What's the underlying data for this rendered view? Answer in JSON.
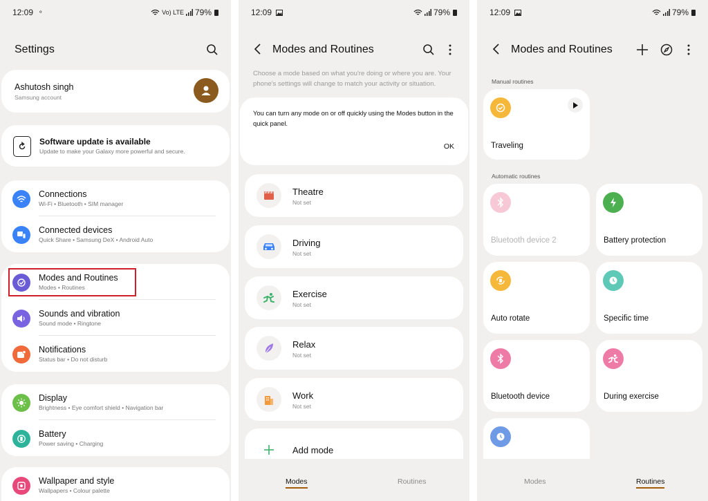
{
  "settings": {
    "status": {
      "time": "12:09",
      "battery": "79%",
      "net_label": "Vo) LTE"
    },
    "title": "Settings",
    "profile": {
      "name": "Ashutosh singh",
      "sub": "Samsung account"
    },
    "update": {
      "title": "Software update is available",
      "sub": "Update to make your Galaxy more powerful and secure."
    },
    "items": [
      {
        "title": "Connections",
        "sub": "Wi-Fi  •  Bluetooth  •  SIM manager",
        "icon": "wifi-icon",
        "color": "#3a82f7"
      },
      {
        "title": "Connected devices",
        "sub": "Quick Share  •  Samsung DeX  •  Android Auto",
        "icon": "devices-icon",
        "color": "#3a82f7"
      },
      {
        "title": "Modes and Routines",
        "sub": "Modes  •  Routines",
        "icon": "modes-icon",
        "color": "#6a5cd6"
      },
      {
        "title": "Sounds and vibration",
        "sub": "Sound mode  •  Ringtone",
        "icon": "sound-icon",
        "color": "#7a63e0"
      },
      {
        "title": "Notifications",
        "sub": "Status bar  •  Do not disturb",
        "icon": "notification-icon",
        "color": "#f06a3a"
      },
      {
        "title": "Display",
        "sub": "Brightness  •  Eye comfort shield  •  Navigation bar",
        "icon": "brightness-icon",
        "color": "#6cc04a"
      },
      {
        "title": "Battery",
        "sub": "Power saving  •  Charging",
        "icon": "battery-icon",
        "color": "#2eb39b"
      },
      {
        "title": "Wallpaper and style",
        "sub": "Wallpapers  •  Colour palette",
        "icon": "wallpaper-icon",
        "color": "#e8497a"
      }
    ]
  },
  "modes": {
    "status": {
      "time": "12:09",
      "battery": "79%"
    },
    "title": "Modes and Routines",
    "description": "Choose a mode based on what you're doing or where you are. Your phone's settings will change to match your activity or situation.",
    "notice": "You can turn any mode on or off quickly using the Modes button in the quick panel.",
    "ok": "OK",
    "list": [
      {
        "title": "Theatre",
        "sub": "Not set",
        "icon": "theatre-icon"
      },
      {
        "title": "Driving",
        "sub": "Not set",
        "icon": "car-icon"
      },
      {
        "title": "Exercise",
        "sub": "Not set",
        "icon": "exercise-icon"
      },
      {
        "title": "Relax",
        "sub": "Not set",
        "icon": "leaf-icon"
      },
      {
        "title": "Work",
        "sub": "Not set",
        "icon": "work-icon"
      }
    ],
    "add": "Add mode",
    "tabs": {
      "modes": "Modes",
      "routines": "Routines",
      "active": "modes"
    }
  },
  "routines": {
    "status": {
      "time": "12:09",
      "battery": "79%"
    },
    "title": "Modes and Routines",
    "manual_label": "Manual routines",
    "automatic_label": "Automatic routines",
    "manual": [
      {
        "title": "Traveling",
        "icon": "check-circle-icon",
        "color": "#f5b83a"
      }
    ],
    "automatic": [
      {
        "title": "Bluetooth device 2",
        "icon": "bluetooth-icon",
        "color": "#f7c9d6",
        "dim": true
      },
      {
        "title": "Battery protection",
        "icon": "bolt-icon",
        "color": "#4caf50"
      },
      {
        "title": "Auto rotate",
        "icon": "rotate-icon",
        "color": "#f5b83a"
      },
      {
        "title": "Specific time",
        "icon": "clock-icon",
        "color": "#5ec9b6"
      },
      {
        "title": "Bluetooth device",
        "icon": "bluetooth-icon",
        "color": "#ee7aa6"
      },
      {
        "title": "During exercise",
        "icon": "exercise-icon",
        "color": "#ee7aa6"
      },
      {
        "title": "",
        "icon": "clock-icon",
        "color": "#6f9be6"
      }
    ],
    "tabs": {
      "modes": "Modes",
      "routines": "Routines",
      "active": "routines"
    }
  }
}
